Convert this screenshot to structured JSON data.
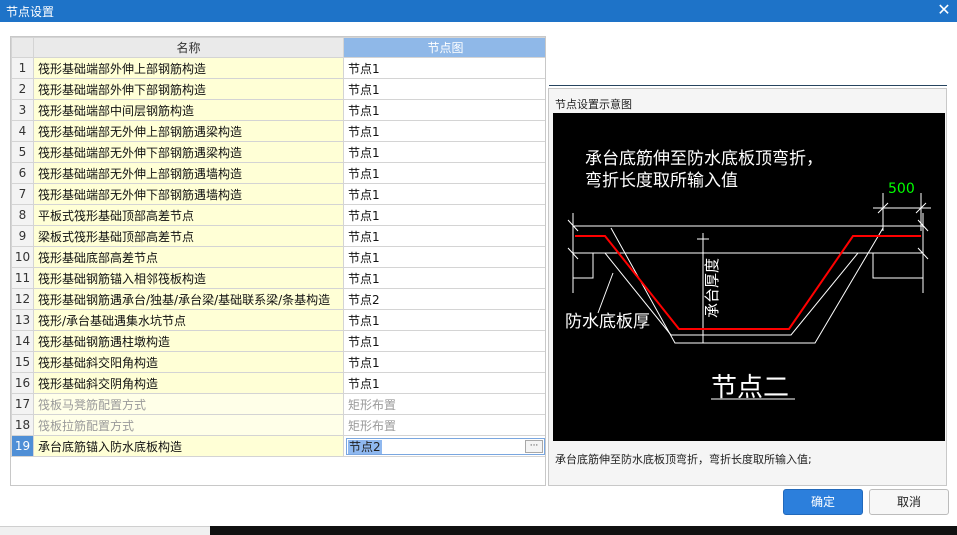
{
  "window": {
    "title": "节点设置",
    "close_glyph": "✕"
  },
  "table": {
    "headers": {
      "name": "名称",
      "figure": "节点图"
    },
    "rows": [
      {
        "num": "1",
        "name": "筏形基础端部外伸上部钢筋构造",
        "value": "节点1"
      },
      {
        "num": "2",
        "name": "筏形基础端部外伸下部钢筋构造",
        "value": "节点1"
      },
      {
        "num": "3",
        "name": "筏形基础端部中间层钢筋构造",
        "value": "节点1"
      },
      {
        "num": "4",
        "name": "筏形基础端部无外伸上部钢筋遇梁构造",
        "value": "节点1"
      },
      {
        "num": "5",
        "name": "筏形基础端部无外伸下部钢筋遇梁构造",
        "value": "节点1"
      },
      {
        "num": "6",
        "name": "筏形基础端部无外伸上部钢筋遇墙构造",
        "value": "节点1"
      },
      {
        "num": "7",
        "name": "筏形基础端部无外伸下部钢筋遇墙构造",
        "value": "节点1"
      },
      {
        "num": "8",
        "name": "平板式筏形基础顶部高差节点",
        "value": "节点1"
      },
      {
        "num": "9",
        "name": "梁板式筏形基础顶部高差节点",
        "value": "节点1"
      },
      {
        "num": "10",
        "name": "筏形基础底部高差节点",
        "value": "节点1"
      },
      {
        "num": "11",
        "name": "筏形基础钢筋锚入相邻筏板构造",
        "value": "节点1"
      },
      {
        "num": "12",
        "name": "筏形基础钢筋遇承台/独基/承台梁/基础联系梁/条基构造",
        "value": "节点2"
      },
      {
        "num": "13",
        "name": "筏形/承台基础遇集水坑节点",
        "value": "节点1"
      },
      {
        "num": "14",
        "name": "筏形基础钢筋遇柱墩构造",
        "value": "节点1"
      },
      {
        "num": "15",
        "name": "筏形基础斜交阳角构造",
        "value": "节点1"
      },
      {
        "num": "16",
        "name": "筏形基础斜交阴角构造",
        "value": "节点1"
      },
      {
        "num": "17",
        "name": "筏板马凳筋配置方式",
        "value": "矩形布置",
        "dim": true
      },
      {
        "num": "18",
        "name": "筏板拉筋配置方式",
        "value": "矩形布置",
        "dim": true
      },
      {
        "num": "19",
        "name": "承台底筋锚入防水底板构造",
        "value": "节点2",
        "active": true
      }
    ],
    "more_glyph": "···"
  },
  "preview": {
    "caption": "节点设置示意图",
    "figure": {
      "line1": "承台底筋伸至防水底板顶弯折，",
      "line2": "弯折长度取所输入值",
      "dim_value": "500",
      "label_thickness": "承台厚度",
      "label_waterproof": "防水底板厚",
      "node_title": "节点二"
    },
    "description": "承台底筋伸至防水底板顶弯折，弯折长度取所输入值;"
  },
  "buttons": {
    "ok": "确定",
    "cancel": "取消"
  },
  "colors": {
    "titlebar": "#1e73c8",
    "ok_button": "#2c7fdc",
    "rebar": "#ff0000",
    "dimension_text": "#00ff00"
  }
}
